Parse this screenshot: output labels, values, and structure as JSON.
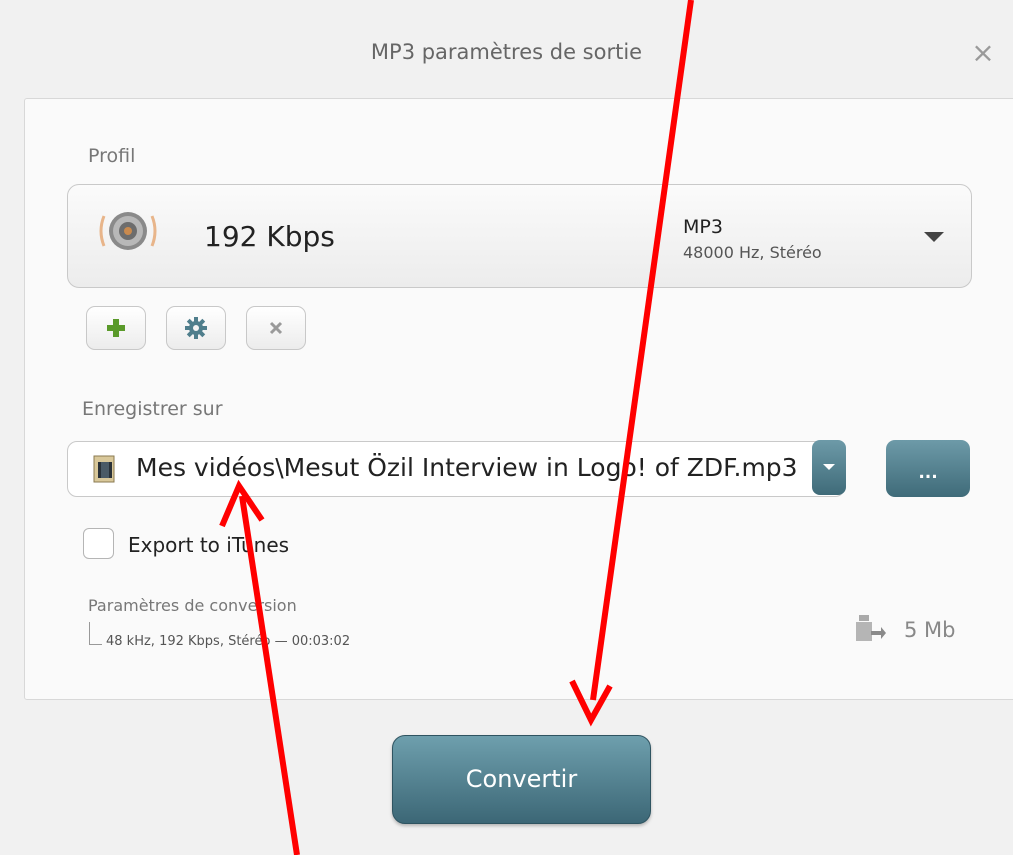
{
  "window": {
    "title": "MP3 paramètres de sortie",
    "close_icon": "×"
  },
  "profile": {
    "label": "Profil",
    "bitrate": "192 Kbps",
    "format": "MP3",
    "format_detail": "48000 Hz,  Stéréo",
    "icon": "speaker-icon"
  },
  "profile_actions": {
    "add_icon": "plus-icon",
    "settings_icon": "gear-icon",
    "delete_icon": "x-icon"
  },
  "save": {
    "label": "Enregistrer sur",
    "path": "Mes vidéos\\Mesut Özil Interview in Logo! of ZDF.mp3",
    "browse_label": "..."
  },
  "export": {
    "label": "Export to iTunes",
    "checked": false
  },
  "conversion": {
    "title": "Paramètres de conversion",
    "detail": "48 kHz, 192 Kbps, Stéréo — 00:03:02",
    "size": "5 Mb"
  },
  "actions": {
    "convert_label": "Convertir"
  },
  "colors": {
    "accent": "#4f7e8c",
    "annotation_arrow": "#ff0000"
  }
}
